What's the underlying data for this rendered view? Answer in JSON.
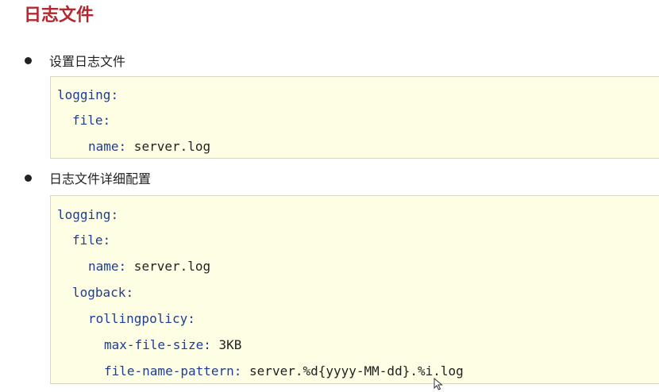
{
  "section": {
    "title": "日志文件"
  },
  "bullets": [
    {
      "label": "设置日志文件"
    },
    {
      "label": "日志文件详细配置"
    }
  ],
  "code_blocks": [
    {
      "lines": [
        {
          "key": "logging",
          "sep": ":",
          "value": ""
        },
        {
          "key": "file",
          "sep": ":",
          "value": ""
        },
        {
          "key": "name",
          "sep": ":",
          "value": " server.log"
        }
      ]
    },
    {
      "lines": [
        {
          "key": "logging",
          "sep": ":",
          "value": ""
        },
        {
          "key": "file",
          "sep": ":",
          "value": ""
        },
        {
          "key": "name",
          "sep": ":",
          "value": " server.log"
        },
        {
          "key": "logback",
          "sep": ":",
          "value": ""
        },
        {
          "key": "rollingpolicy",
          "sep": ":",
          "value": ""
        },
        {
          "key": "max-file-size",
          "sep": ":",
          "value": " 3KB"
        },
        {
          "key": "file-name-pattern",
          "sep": ":",
          "value": " server.%d{yyyy-MM-dd}.%i.log"
        }
      ]
    }
  ],
  "colors": {
    "title": "#b2282e",
    "code_key": "#1f3d94",
    "code_background": "#fefee4"
  },
  "icons": {
    "cursor": "mouse-pointer-icon"
  }
}
